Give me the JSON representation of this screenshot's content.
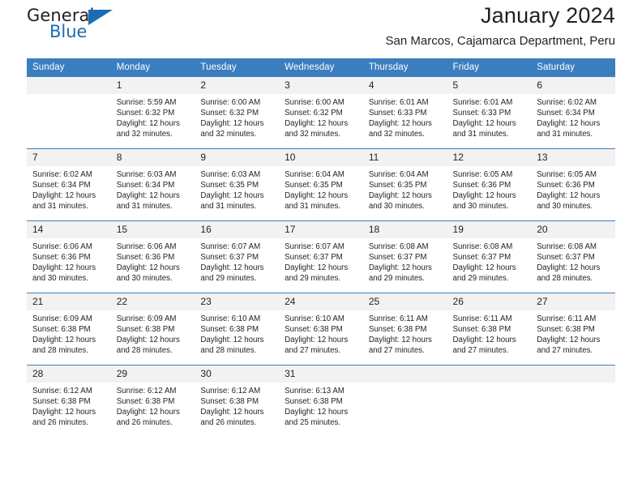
{
  "brand": {
    "name_part1": "General",
    "name_part2": "Blue",
    "accent_color": "#1b6cb5"
  },
  "header": {
    "title": "January 2024",
    "location": "San Marcos, Cajamarca Department, Peru"
  },
  "calendar": {
    "header_bg": "#3b7ec0",
    "daynum_bg": "#f2f2f2",
    "weekday_headers": [
      "Sunday",
      "Monday",
      "Tuesday",
      "Wednesday",
      "Thursday",
      "Friday",
      "Saturday"
    ],
    "weeks": [
      [
        {
          "day": "",
          "sunrise": "",
          "sunset": "",
          "daylight_line1": "",
          "daylight_line2": ""
        },
        {
          "day": "1",
          "sunrise": "Sunrise: 5:59 AM",
          "sunset": "Sunset: 6:32 PM",
          "daylight_line1": "Daylight: 12 hours",
          "daylight_line2": "and 32 minutes."
        },
        {
          "day": "2",
          "sunrise": "Sunrise: 6:00 AM",
          "sunset": "Sunset: 6:32 PM",
          "daylight_line1": "Daylight: 12 hours",
          "daylight_line2": "and 32 minutes."
        },
        {
          "day": "3",
          "sunrise": "Sunrise: 6:00 AM",
          "sunset": "Sunset: 6:32 PM",
          "daylight_line1": "Daylight: 12 hours",
          "daylight_line2": "and 32 minutes."
        },
        {
          "day": "4",
          "sunrise": "Sunrise: 6:01 AM",
          "sunset": "Sunset: 6:33 PM",
          "daylight_line1": "Daylight: 12 hours",
          "daylight_line2": "and 32 minutes."
        },
        {
          "day": "5",
          "sunrise": "Sunrise: 6:01 AM",
          "sunset": "Sunset: 6:33 PM",
          "daylight_line1": "Daylight: 12 hours",
          "daylight_line2": "and 31 minutes."
        },
        {
          "day": "6",
          "sunrise": "Sunrise: 6:02 AM",
          "sunset": "Sunset: 6:34 PM",
          "daylight_line1": "Daylight: 12 hours",
          "daylight_line2": "and 31 minutes."
        }
      ],
      [
        {
          "day": "7",
          "sunrise": "Sunrise: 6:02 AM",
          "sunset": "Sunset: 6:34 PM",
          "daylight_line1": "Daylight: 12 hours",
          "daylight_line2": "and 31 minutes."
        },
        {
          "day": "8",
          "sunrise": "Sunrise: 6:03 AM",
          "sunset": "Sunset: 6:34 PM",
          "daylight_line1": "Daylight: 12 hours",
          "daylight_line2": "and 31 minutes."
        },
        {
          "day": "9",
          "sunrise": "Sunrise: 6:03 AM",
          "sunset": "Sunset: 6:35 PM",
          "daylight_line1": "Daylight: 12 hours",
          "daylight_line2": "and 31 minutes."
        },
        {
          "day": "10",
          "sunrise": "Sunrise: 6:04 AM",
          "sunset": "Sunset: 6:35 PM",
          "daylight_line1": "Daylight: 12 hours",
          "daylight_line2": "and 31 minutes."
        },
        {
          "day": "11",
          "sunrise": "Sunrise: 6:04 AM",
          "sunset": "Sunset: 6:35 PM",
          "daylight_line1": "Daylight: 12 hours",
          "daylight_line2": "and 30 minutes."
        },
        {
          "day": "12",
          "sunrise": "Sunrise: 6:05 AM",
          "sunset": "Sunset: 6:36 PM",
          "daylight_line1": "Daylight: 12 hours",
          "daylight_line2": "and 30 minutes."
        },
        {
          "day": "13",
          "sunrise": "Sunrise: 6:05 AM",
          "sunset": "Sunset: 6:36 PM",
          "daylight_line1": "Daylight: 12 hours",
          "daylight_line2": "and 30 minutes."
        }
      ],
      [
        {
          "day": "14",
          "sunrise": "Sunrise: 6:06 AM",
          "sunset": "Sunset: 6:36 PM",
          "daylight_line1": "Daylight: 12 hours",
          "daylight_line2": "and 30 minutes."
        },
        {
          "day": "15",
          "sunrise": "Sunrise: 6:06 AM",
          "sunset": "Sunset: 6:36 PM",
          "daylight_line1": "Daylight: 12 hours",
          "daylight_line2": "and 30 minutes."
        },
        {
          "day": "16",
          "sunrise": "Sunrise: 6:07 AM",
          "sunset": "Sunset: 6:37 PM",
          "daylight_line1": "Daylight: 12 hours",
          "daylight_line2": "and 29 minutes."
        },
        {
          "day": "17",
          "sunrise": "Sunrise: 6:07 AM",
          "sunset": "Sunset: 6:37 PM",
          "daylight_line1": "Daylight: 12 hours",
          "daylight_line2": "and 29 minutes."
        },
        {
          "day": "18",
          "sunrise": "Sunrise: 6:08 AM",
          "sunset": "Sunset: 6:37 PM",
          "daylight_line1": "Daylight: 12 hours",
          "daylight_line2": "and 29 minutes."
        },
        {
          "day": "19",
          "sunrise": "Sunrise: 6:08 AM",
          "sunset": "Sunset: 6:37 PM",
          "daylight_line1": "Daylight: 12 hours",
          "daylight_line2": "and 29 minutes."
        },
        {
          "day": "20",
          "sunrise": "Sunrise: 6:08 AM",
          "sunset": "Sunset: 6:37 PM",
          "daylight_line1": "Daylight: 12 hours",
          "daylight_line2": "and 28 minutes."
        }
      ],
      [
        {
          "day": "21",
          "sunrise": "Sunrise: 6:09 AM",
          "sunset": "Sunset: 6:38 PM",
          "daylight_line1": "Daylight: 12 hours",
          "daylight_line2": "and 28 minutes."
        },
        {
          "day": "22",
          "sunrise": "Sunrise: 6:09 AM",
          "sunset": "Sunset: 6:38 PM",
          "daylight_line1": "Daylight: 12 hours",
          "daylight_line2": "and 28 minutes."
        },
        {
          "day": "23",
          "sunrise": "Sunrise: 6:10 AM",
          "sunset": "Sunset: 6:38 PM",
          "daylight_line1": "Daylight: 12 hours",
          "daylight_line2": "and 28 minutes."
        },
        {
          "day": "24",
          "sunrise": "Sunrise: 6:10 AM",
          "sunset": "Sunset: 6:38 PM",
          "daylight_line1": "Daylight: 12 hours",
          "daylight_line2": "and 27 minutes."
        },
        {
          "day": "25",
          "sunrise": "Sunrise: 6:11 AM",
          "sunset": "Sunset: 6:38 PM",
          "daylight_line1": "Daylight: 12 hours",
          "daylight_line2": "and 27 minutes."
        },
        {
          "day": "26",
          "sunrise": "Sunrise: 6:11 AM",
          "sunset": "Sunset: 6:38 PM",
          "daylight_line1": "Daylight: 12 hours",
          "daylight_line2": "and 27 minutes."
        },
        {
          "day": "27",
          "sunrise": "Sunrise: 6:11 AM",
          "sunset": "Sunset: 6:38 PM",
          "daylight_line1": "Daylight: 12 hours",
          "daylight_line2": "and 27 minutes."
        }
      ],
      [
        {
          "day": "28",
          "sunrise": "Sunrise: 6:12 AM",
          "sunset": "Sunset: 6:38 PM",
          "daylight_line1": "Daylight: 12 hours",
          "daylight_line2": "and 26 minutes."
        },
        {
          "day": "29",
          "sunrise": "Sunrise: 6:12 AM",
          "sunset": "Sunset: 6:38 PM",
          "daylight_line1": "Daylight: 12 hours",
          "daylight_line2": "and 26 minutes."
        },
        {
          "day": "30",
          "sunrise": "Sunrise: 6:12 AM",
          "sunset": "Sunset: 6:38 PM",
          "daylight_line1": "Daylight: 12 hours",
          "daylight_line2": "and 26 minutes."
        },
        {
          "day": "31",
          "sunrise": "Sunrise: 6:13 AM",
          "sunset": "Sunset: 6:38 PM",
          "daylight_line1": "Daylight: 12 hours",
          "daylight_line2": "and 25 minutes."
        },
        {
          "day": "",
          "sunrise": "",
          "sunset": "",
          "daylight_line1": "",
          "daylight_line2": ""
        },
        {
          "day": "",
          "sunrise": "",
          "sunset": "",
          "daylight_line1": "",
          "daylight_line2": ""
        },
        {
          "day": "",
          "sunrise": "",
          "sunset": "",
          "daylight_line1": "",
          "daylight_line2": ""
        }
      ]
    ]
  }
}
